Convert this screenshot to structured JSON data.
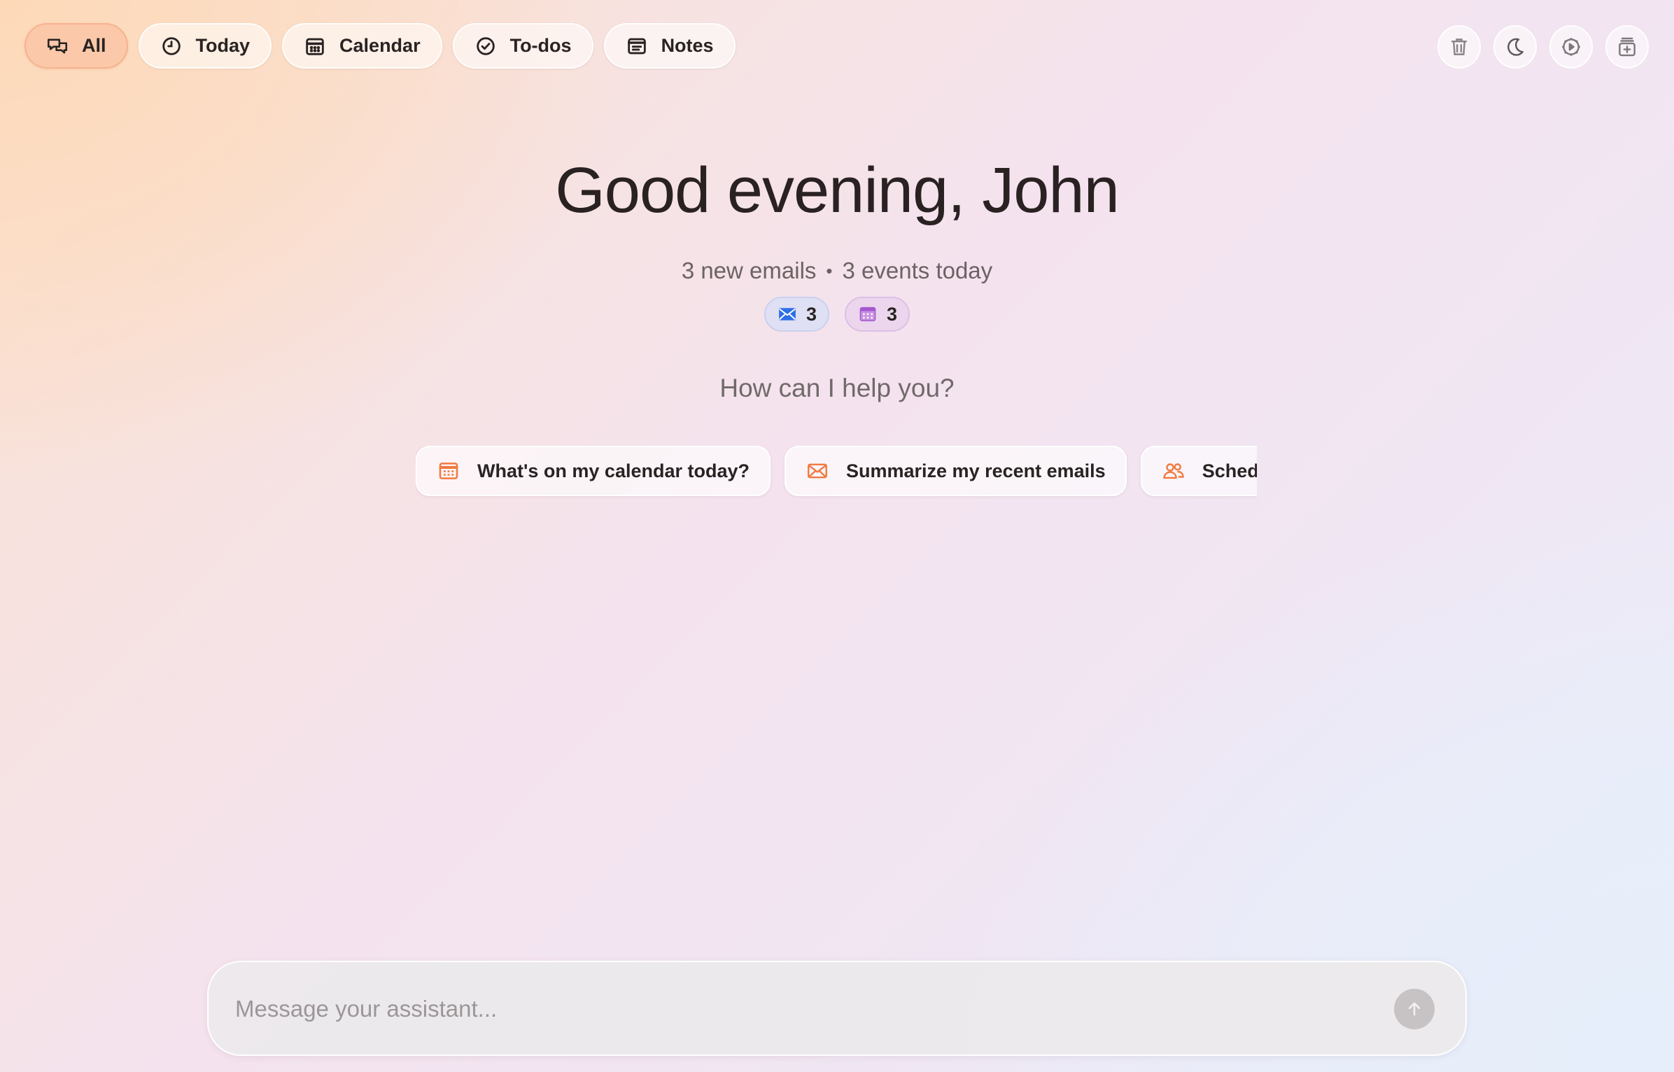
{
  "nav": {
    "tabs": [
      {
        "label": "All",
        "icon": "chat-bubbles-icon"
      },
      {
        "label": "Today",
        "icon": "clock-icon"
      },
      {
        "label": "Calendar",
        "icon": "calendar-icon"
      },
      {
        "label": "To-dos",
        "icon": "check-circle-icon"
      },
      {
        "label": "Notes",
        "icon": "note-icon"
      }
    ],
    "active": "All"
  },
  "toolbar": {
    "icons": [
      "trash-icon",
      "moon-icon",
      "settings-icon",
      "new-chat-icon"
    ]
  },
  "hero": {
    "greeting": "Good evening, John",
    "emails_summary": "3 new emails",
    "separator": "•",
    "events_summary": "3 events today",
    "email_badge_count": "3",
    "event_badge_count": "3",
    "help_prompt": "How can I help you?"
  },
  "suggestions": [
    {
      "label": "What's on my calendar today?",
      "icon": "calendar-icon"
    },
    {
      "label": "Summarize my recent emails",
      "icon": "mail-icon"
    },
    {
      "label": "Schedule",
      "icon": "people-icon"
    }
  ],
  "composer": {
    "placeholder": "Message your assistant..."
  },
  "colors": {
    "accent": "#f07a3f",
    "active_tab_bg": "#fbc8aa",
    "mail_blue": "#2d6fe6",
    "calendar_purple": "#a35ad0",
    "text_dark": "#2a2323",
    "text_muted": "#6b6363"
  }
}
